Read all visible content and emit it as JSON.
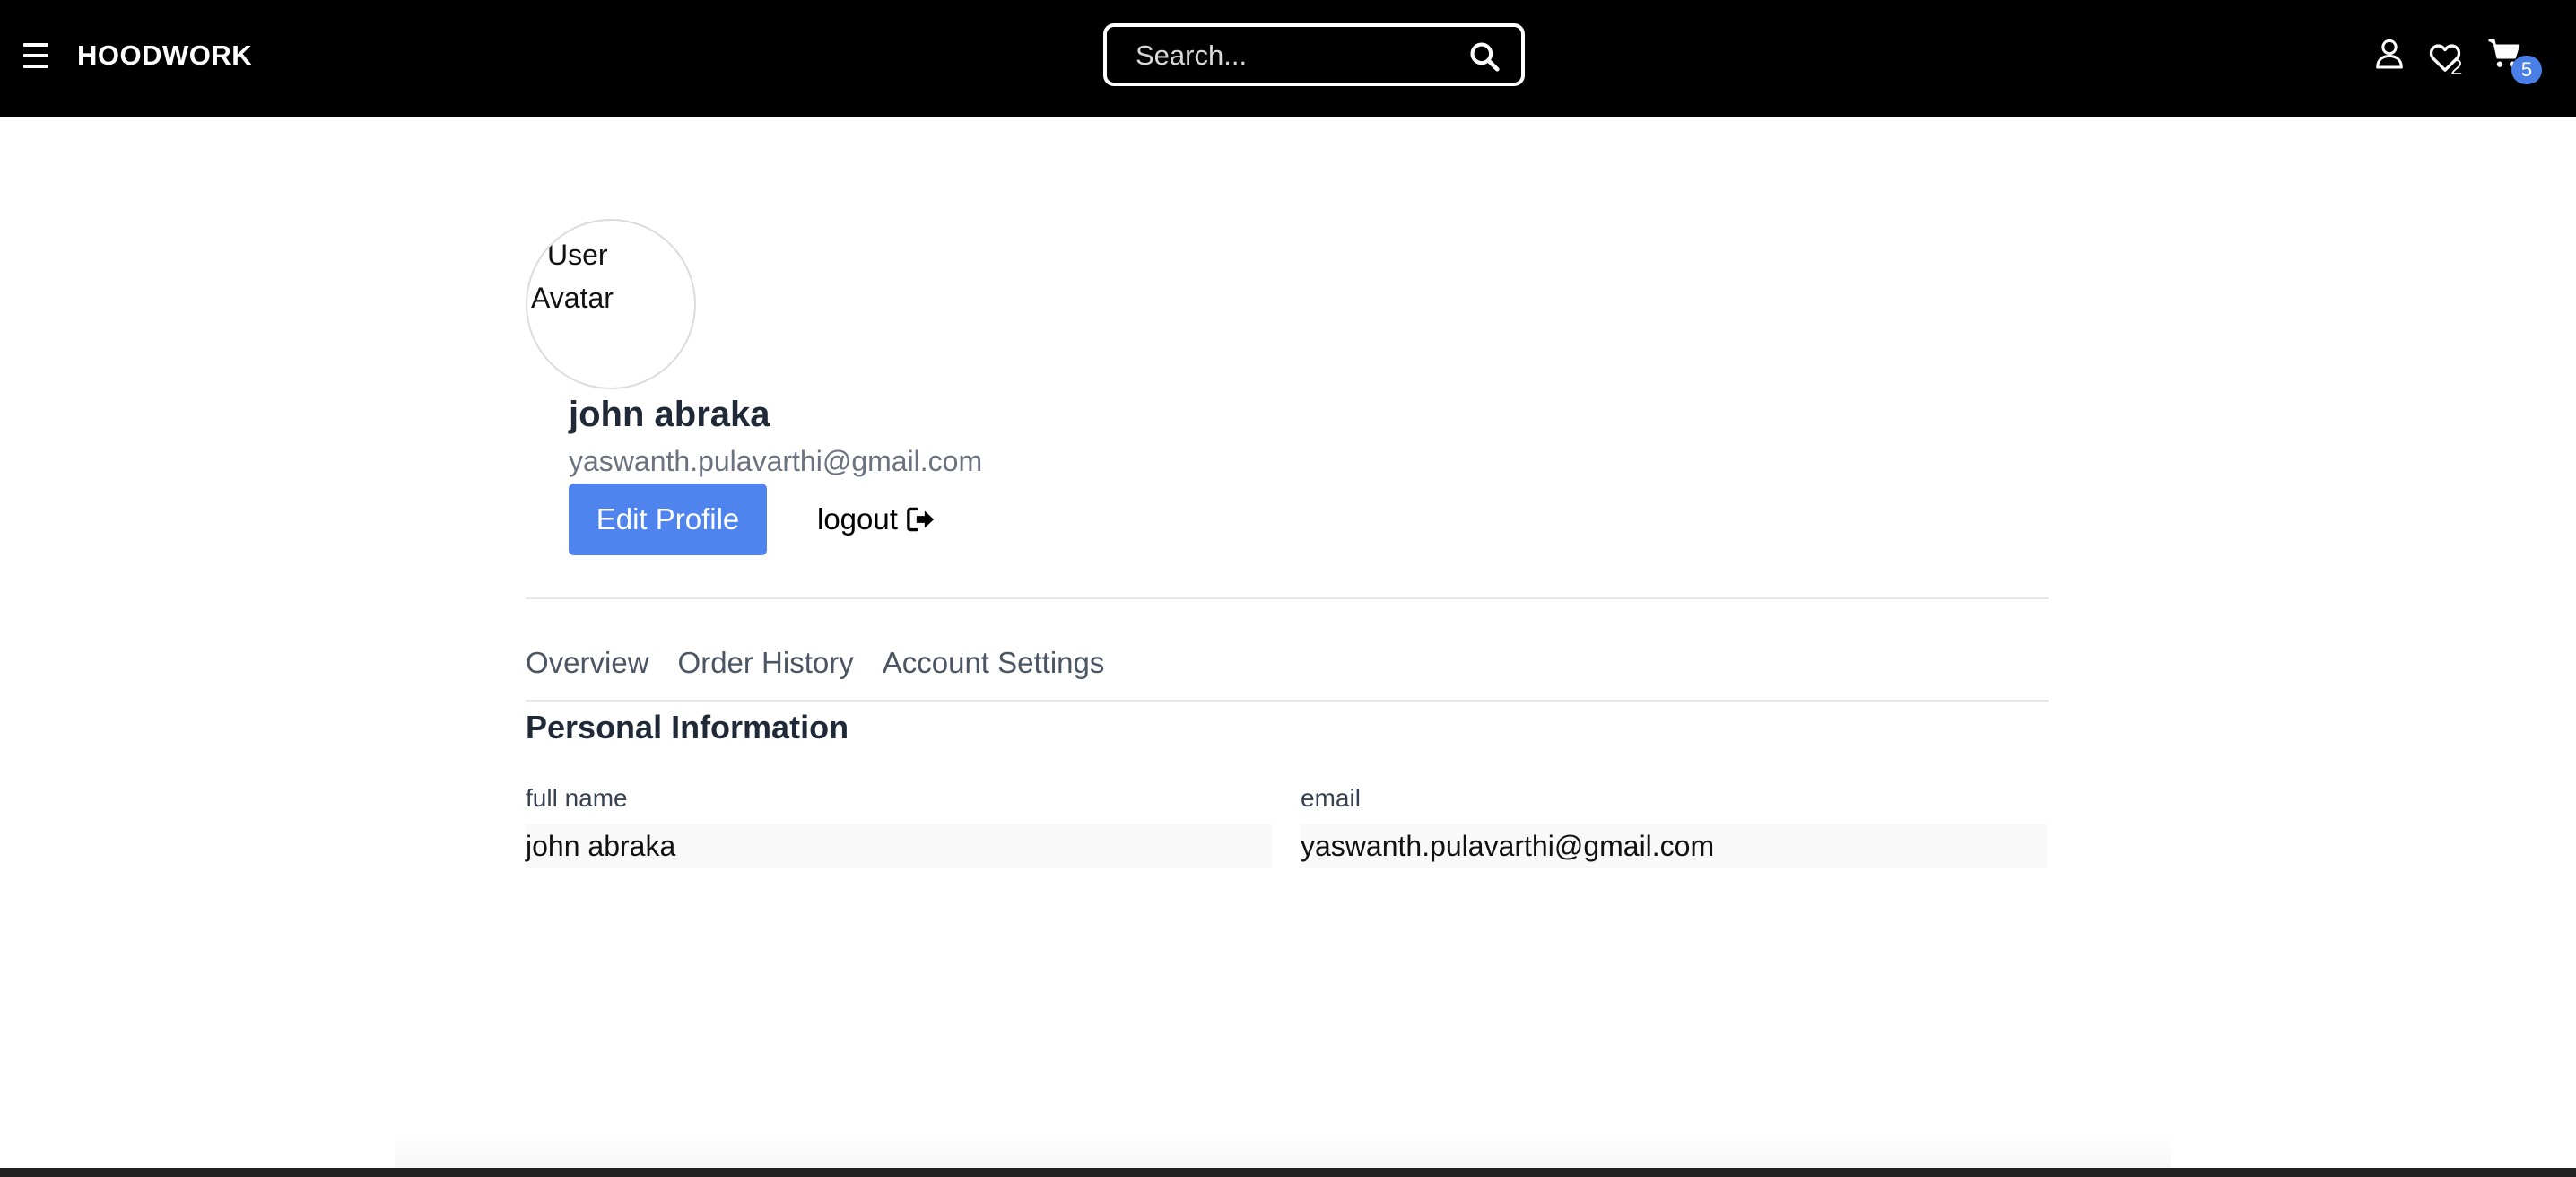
{
  "header": {
    "brand": "HOODWORK",
    "search_placeholder": "Search...",
    "wishlist_count": "2",
    "cart_count": "5"
  },
  "profile": {
    "avatar_alt": "User Avatar",
    "name": "john abraka",
    "email": "yaswanth.pulavarthi@gmail.com",
    "edit_label": "Edit Profile",
    "logout_label": "logout"
  },
  "tabs": [
    {
      "label": "Overview"
    },
    {
      "label": "Order History"
    },
    {
      "label": "Account Settings"
    }
  ],
  "personal_info": {
    "title": "Personal Information",
    "full_name_label": "full name",
    "full_name_value": "john abraka",
    "email_label": "email",
    "email_value": "yaswanth.pulavarthi@gmail.com"
  },
  "colors": {
    "navbar": "#000000",
    "accent": "#4f84ee",
    "badge": "#4a7fe8"
  },
  "icons": {
    "menu": "hamburger-icon",
    "search": "search-icon",
    "user": "user-icon",
    "wishlist": "heart-icon",
    "cart": "cart-icon",
    "logout": "logout-icon"
  }
}
